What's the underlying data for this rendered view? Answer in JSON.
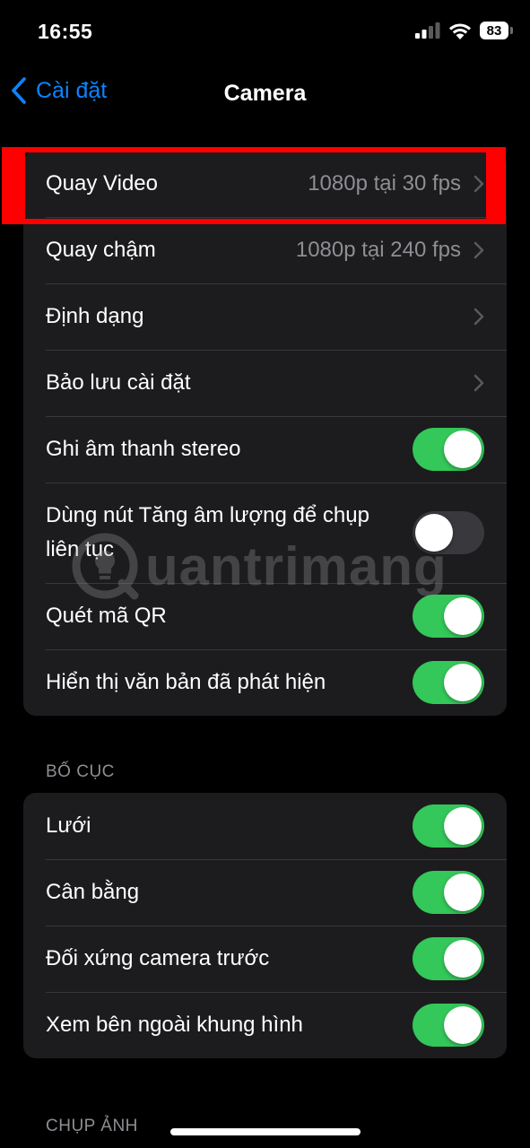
{
  "status_bar": {
    "time": "16:55",
    "battery": "83",
    "icons": [
      "cellular-signal-icon",
      "wifi-icon",
      "battery-icon"
    ]
  },
  "nav": {
    "back_label": "Cài đặt",
    "title": "Camera"
  },
  "group1": {
    "rows": [
      {
        "label": "Quay Video",
        "value": "1080p tại 30 fps",
        "type": "chevron"
      },
      {
        "label": "Quay chậm",
        "value": "1080p tại 240 fps",
        "type": "chevron"
      },
      {
        "label": "Định dạng",
        "type": "chevron"
      },
      {
        "label": "Bảo lưu cài đặt",
        "type": "chevron"
      },
      {
        "label": "Ghi âm thanh stereo",
        "type": "toggle",
        "on": true
      },
      {
        "label": "Dùng nút Tăng âm lượng để chụp liên tục",
        "type": "toggle",
        "on": false
      },
      {
        "label": "Quét mã QR",
        "type": "toggle",
        "on": true
      },
      {
        "label": "Hiển thị văn bản đã phát hiện",
        "type": "toggle",
        "on": true
      }
    ]
  },
  "section_layout": {
    "header": "BỐ CỤC",
    "rows": [
      {
        "label": "Lưới",
        "type": "toggle",
        "on": true
      },
      {
        "label": "Cân bằng",
        "type": "toggle",
        "on": true
      },
      {
        "label": "Đối xứng camera trước",
        "type": "toggle",
        "on": true
      },
      {
        "label": "Xem bên ngoài khung hình",
        "type": "toggle",
        "on": true
      }
    ]
  },
  "section_photo": {
    "header": "CHỤP ẢNH"
  },
  "watermark": {
    "text": "uantrimang"
  },
  "colors": {
    "accent": "#0a84ff",
    "toggle_on": "#34c759",
    "toggle_off": "#39393d",
    "highlight": "#ff0000",
    "cell_background": "#1c1c1e"
  }
}
